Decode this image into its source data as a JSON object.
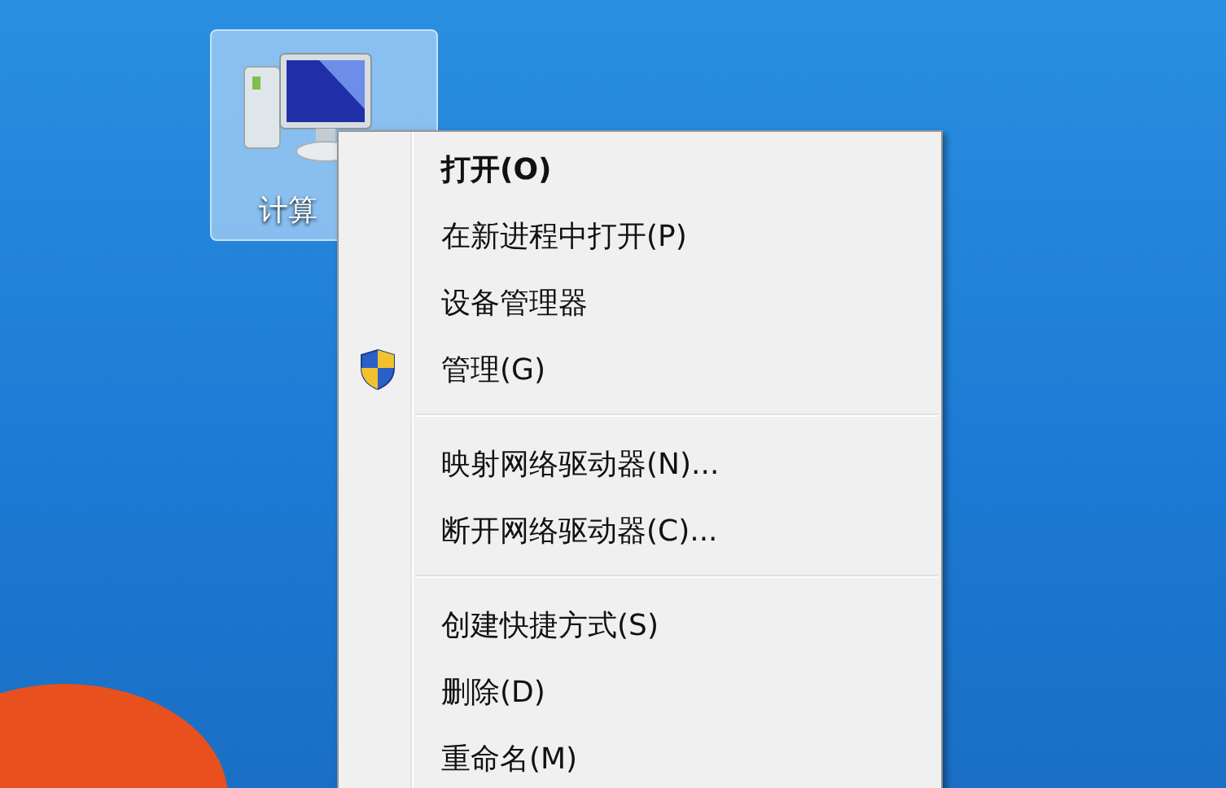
{
  "desktop_icon": {
    "label": "计算",
    "selected": true
  },
  "context_menu": {
    "items": [
      {
        "kind": "item",
        "label": "打开(O)",
        "default": true
      },
      {
        "kind": "item",
        "label": "在新进程中打开(P)",
        "default": false
      },
      {
        "kind": "item",
        "label": "设备管理器",
        "default": false
      },
      {
        "kind": "shield-item",
        "label": "管理(G)",
        "default": false
      },
      {
        "kind": "separator"
      },
      {
        "kind": "item",
        "label": "映射网络驱动器(N)...",
        "default": false
      },
      {
        "kind": "item",
        "label": "断开网络驱动器(C)...",
        "default": false
      },
      {
        "kind": "separator"
      },
      {
        "kind": "item",
        "label": "创建快捷方式(S)",
        "default": false
      },
      {
        "kind": "item",
        "label": "删除(D)",
        "default": false
      },
      {
        "kind": "item",
        "label": "重命名(M)",
        "default": false
      }
    ]
  }
}
